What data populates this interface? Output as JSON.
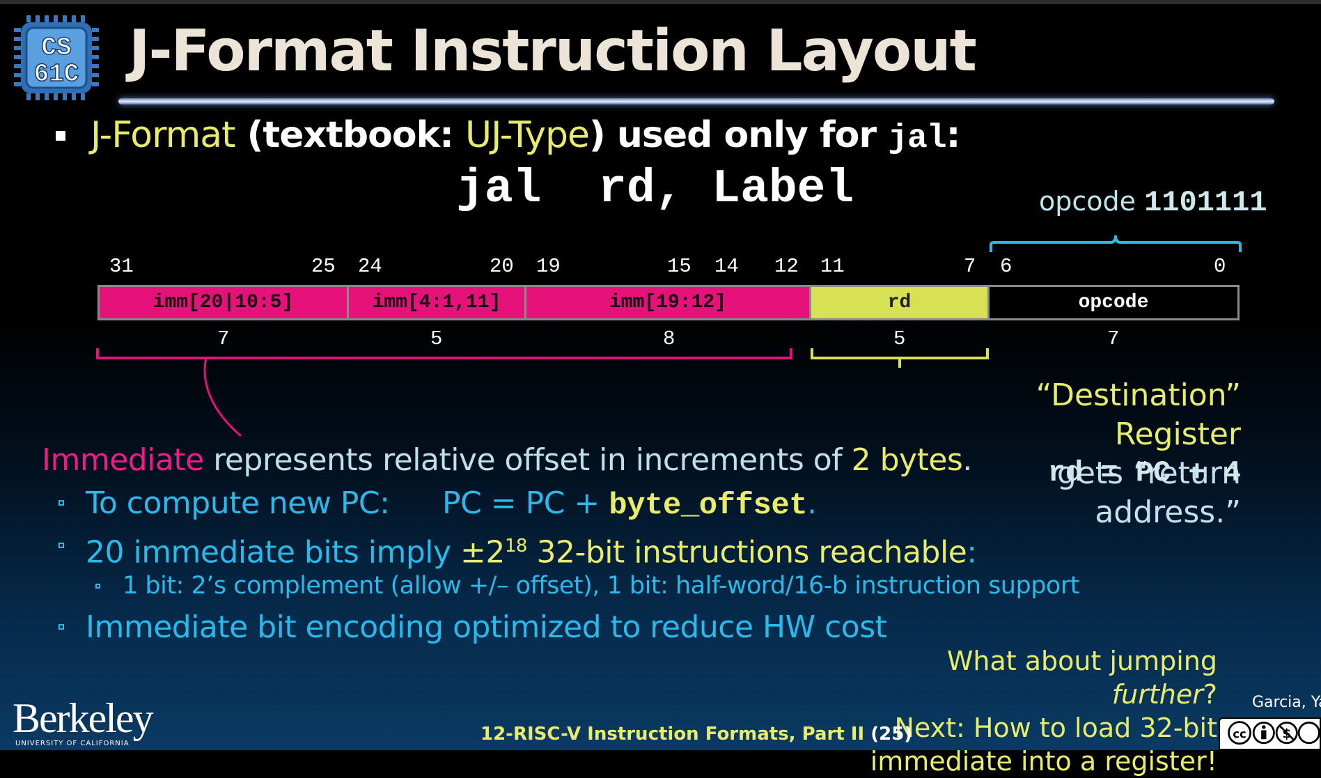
{
  "logo": {
    "line1": "CS",
    "line2": "61C"
  },
  "title": "J-Format Instruction Layout",
  "bullet1": {
    "a": "J-Format",
    "b": " (textbook: ",
    "c": "UJ-Type",
    "d": ") used only for ",
    "e": "jal",
    "f": ":"
  },
  "code_example": "jal  rd, Label",
  "opcode_label": {
    "text": "opcode",
    "value": "1101111"
  },
  "bit_numbers": [
    "31",
    "25",
    "24",
    "20",
    "19",
    "15",
    "14",
    "12",
    "11",
    "7",
    "6",
    "0"
  ],
  "fields": [
    {
      "label": "imm[20|10:5]",
      "width": "7"
    },
    {
      "label": "imm[4:1,11]",
      "width": "5"
    },
    {
      "label": "imm[19:12]",
      "width": "8"
    },
    {
      "label": "rd",
      "width": "5"
    },
    {
      "label": "opcode",
      "width": "7"
    }
  ],
  "destination": {
    "l1": "“Destination” Register",
    "l2": "gets “return address.”",
    "eq": "rd = PC + 4"
  },
  "immediate_line": {
    "a": "Immediate",
    "b": " represents relative offset in increments of ",
    "c": "2 bytes",
    "d": "."
  },
  "sub1": {
    "a": "To compute new PC:",
    "b": "PC = PC + ",
    "c": "byte_offset",
    "d": "."
  },
  "sub2": {
    "a": "20 immediate bits imply ",
    "b": "±2",
    "sup": "18",
    "c": " 32-bit instructions reachable",
    "d": ":"
  },
  "subsub1": "1 bit: 2’s complement (allow +/– offset), 1 bit: half-word/16-b instruction support",
  "sub3": "Immediate bit encoding optimized to reduce HW cost",
  "bottom_question": {
    "l1a": "What about jumping ",
    "l1b": "further",
    "l1c": "?",
    "l2": "Next: How to load 32-bit",
    "l3": "immediate into a register!"
  },
  "berkeley": {
    "name": "Berkeley",
    "sub": "UNIVERSITY OF CALIFORNIA"
  },
  "footer": {
    "text": "12-RISC-V Instruction Formats, Part II ",
    "page": "(25)"
  },
  "author": "Garcia, Yan",
  "license_icon": "cc-by-nc-sa-icon",
  "colors": {
    "immediate": "#e5127a",
    "rd": "#d8e053",
    "accent_yellow": "#e8ec6a",
    "accent_cyan": "#29b9ea"
  }
}
